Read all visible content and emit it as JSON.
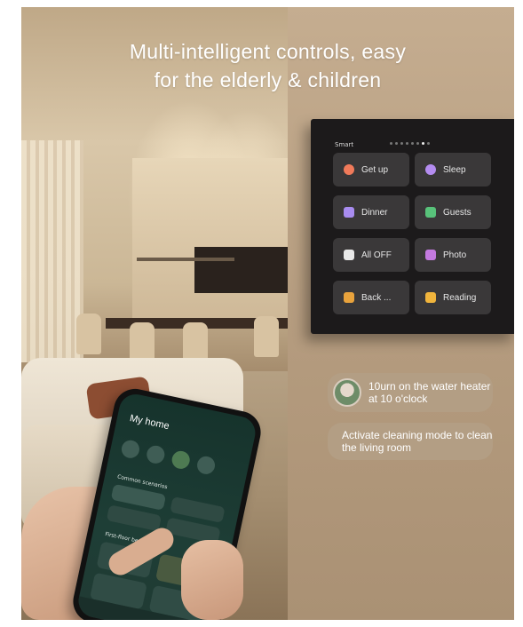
{
  "headline": {
    "line1": "Multi-intelligent controls, easy",
    "line2": "for the elderly & children"
  },
  "panel": {
    "title": "Smart",
    "tiles": [
      {
        "label": "Get up",
        "icon": "sun-icon",
        "color": "#f07a5a"
      },
      {
        "label": "Sleep",
        "icon": "moon-icon",
        "color": "#b48cf0"
      },
      {
        "label": "Dinner",
        "icon": "bowl-icon",
        "color": "#a88cf0"
      },
      {
        "label": "Guests",
        "icon": "sofa-icon",
        "color": "#58c27a"
      },
      {
        "label": "All OFF",
        "icon": "lamp-icon",
        "color": "#e8e8e8"
      },
      {
        "label": "Photo",
        "icon": "camera-icon",
        "color": "#c47ae0"
      },
      {
        "label": "Back ...",
        "icon": "walk-icon",
        "color": "#e8a23c"
      },
      {
        "label": "Reading",
        "icon": "book-icon",
        "color": "#f0b43c"
      }
    ]
  },
  "bubbles": [
    {
      "text": "10urn on the water heater at 10 o'clock"
    },
    {
      "text": "Activate cleaning mode to clean the living room"
    }
  ],
  "phone": {
    "title": "My home",
    "subtitle": "",
    "section1": "Common scenarios",
    "section2": "First-floor bedroom"
  }
}
